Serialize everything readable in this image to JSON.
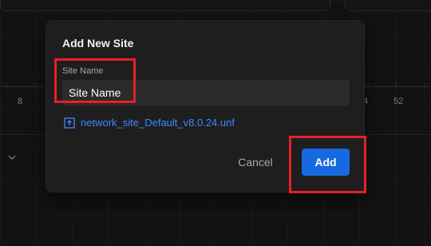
{
  "background": {
    "ruler_left_value": "8",
    "ruler_right_value": "52",
    "ruler_mid_right_value": "4"
  },
  "modal": {
    "title": "Add New Site",
    "site_name": {
      "label": "Site Name",
      "value": "Site Name"
    },
    "file_link": {
      "icon": "upload-file-icon",
      "text": "network_site_Default_v8.0.24.unf"
    },
    "actions": {
      "cancel_label": "Cancel",
      "add_label": "Add"
    }
  },
  "colors": {
    "accent": "#1769e0",
    "link": "#3f89ff",
    "highlight": "#e8202a",
    "modal_bg": "#1e1e1e",
    "input_bg": "#2b2b2b"
  }
}
